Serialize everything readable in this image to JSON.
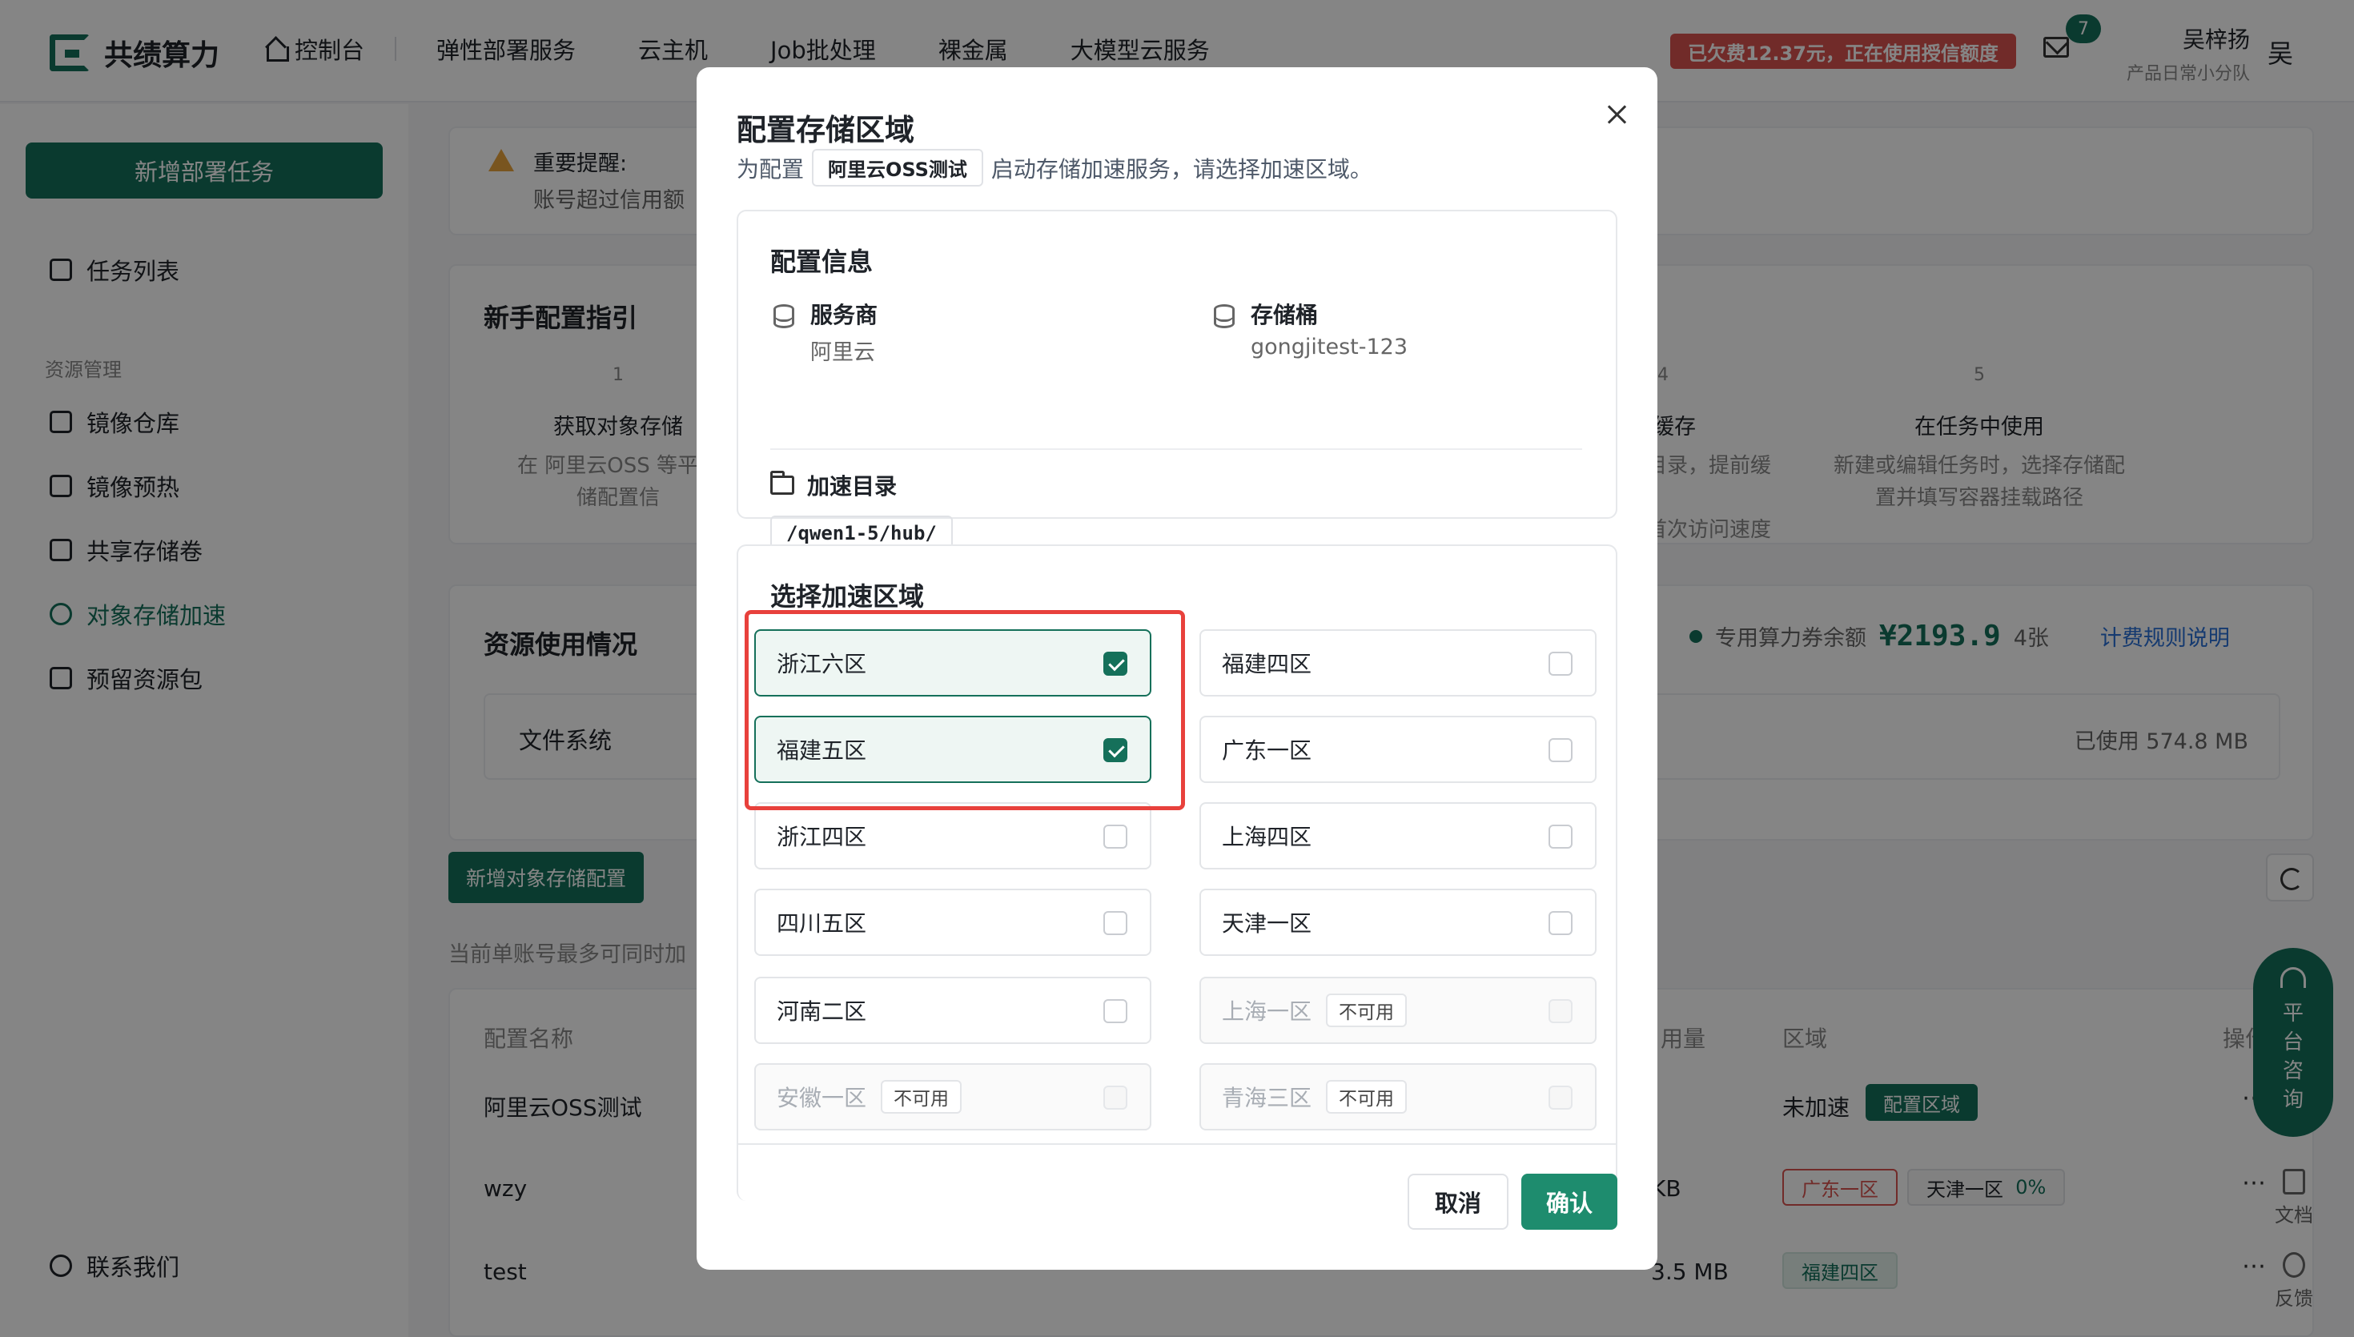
{
  "app": {
    "name": "共绩算力"
  },
  "nav": [
    "控制台",
    "弹性部署服务",
    "云主机",
    "Job批处理",
    "裸金属",
    "大模型云服务"
  ],
  "header": {
    "debt_notice": "已欠费12.37元，正在使用授信额度",
    "mail_count": "7",
    "user_name": "吴梓扬",
    "user_team": "产品日常小分队",
    "avatar_text": "吴"
  },
  "sidebar": {
    "new_task": "新增部署任务",
    "task_list": "任务列表",
    "group": "资源管理",
    "items": [
      "镜像仓库",
      "镜像预热",
      "共享存储卷",
      "对象存储加速",
      "预留资源包"
    ],
    "contact": "联系我们"
  },
  "background": {
    "notice_title": "重要提醒:",
    "notice_body": "账号超过信用额",
    "guide_title": "新手配置指引",
    "steps": [
      {
        "num": "1",
        "title": "获取对象存储",
        "desc1": "在 阿里云OSS 等平台",
        "desc2": "储配置信"
      },
      {
        "num": "4",
        "title": "预热缓存",
        "desc1": "热区域和目录，提前缓存",
        "desc2": "据，提升首次访问速度"
      },
      {
        "num": "5",
        "title": "在任务中使用",
        "desc1": "新建或编辑任务时，选择存储配",
        "desc2": "置并填写容器挂载路径"
      }
    ],
    "usage_title": "资源使用情况",
    "voucher_label": "专用算力券余额",
    "voucher_value": "¥2193.9",
    "voucher_count": "4张",
    "rules_link": "计费规则说明",
    "fs_label": "文件系统",
    "fs_used": "已使用 574.8 MB",
    "add_config": "新增对象存储配置",
    "limit_note": "当前单账号最多可同时加",
    "table_headers": {
      "name": "配置名称",
      "usage": "用量",
      "region": "区域",
      "ops": "操作"
    },
    "rows": [
      {
        "name": "阿里云OSS测试",
        "status": "未加速",
        "tag": "配置区域"
      },
      {
        "name": "wzy",
        "size": "KB",
        "tag1": "广东一区",
        "tag2": "天津一区",
        "pct": "0%"
      },
      {
        "name": "test",
        "size": "3.5 MB",
        "tag": "福建四区"
      }
    ],
    "support": [
      "平",
      "台",
      "咨",
      "询"
    ],
    "doc": "文档",
    "feedback": "反馈"
  },
  "modal": {
    "title": "配置存储区域",
    "subtitle_prefix": "为配置",
    "config_name": "阿里云OSS测试",
    "subtitle_suffix": "启动存储加速服务，请选择加速区域。",
    "info_title": "配置信息",
    "provider_label": "服务商",
    "provider_value": "阿里云",
    "bucket_label": "存储桶",
    "bucket_value": "gongjitest-123",
    "dir_label": "加速目录",
    "dir_value": "/qwen1-5/hub/",
    "region_title": "选择加速区域",
    "unavailable": "不可用",
    "regions": [
      {
        "name": "浙江六区",
        "checked": true,
        "disabled": false
      },
      {
        "name": "福建四区",
        "checked": false,
        "disabled": false
      },
      {
        "name": "福建五区",
        "checked": true,
        "disabled": false
      },
      {
        "name": "广东一区",
        "checked": false,
        "disabled": false
      },
      {
        "name": "浙江四区",
        "checked": false,
        "disabled": false
      },
      {
        "name": "上海四区",
        "checked": false,
        "disabled": false
      },
      {
        "name": "四川五区",
        "checked": false,
        "disabled": false
      },
      {
        "name": "天津一区",
        "checked": false,
        "disabled": false
      },
      {
        "name": "河南二区",
        "checked": false,
        "disabled": false
      },
      {
        "name": "上海一区",
        "checked": false,
        "disabled": true
      },
      {
        "name": "安徽一区",
        "checked": false,
        "disabled": true
      },
      {
        "name": "青海三区",
        "checked": false,
        "disabled": true
      }
    ],
    "cancel": "取消",
    "confirm": "确认"
  },
  "colors": {
    "brand": "#15705a",
    "danger": "#d9534f",
    "link": "#2a6fd6"
  }
}
